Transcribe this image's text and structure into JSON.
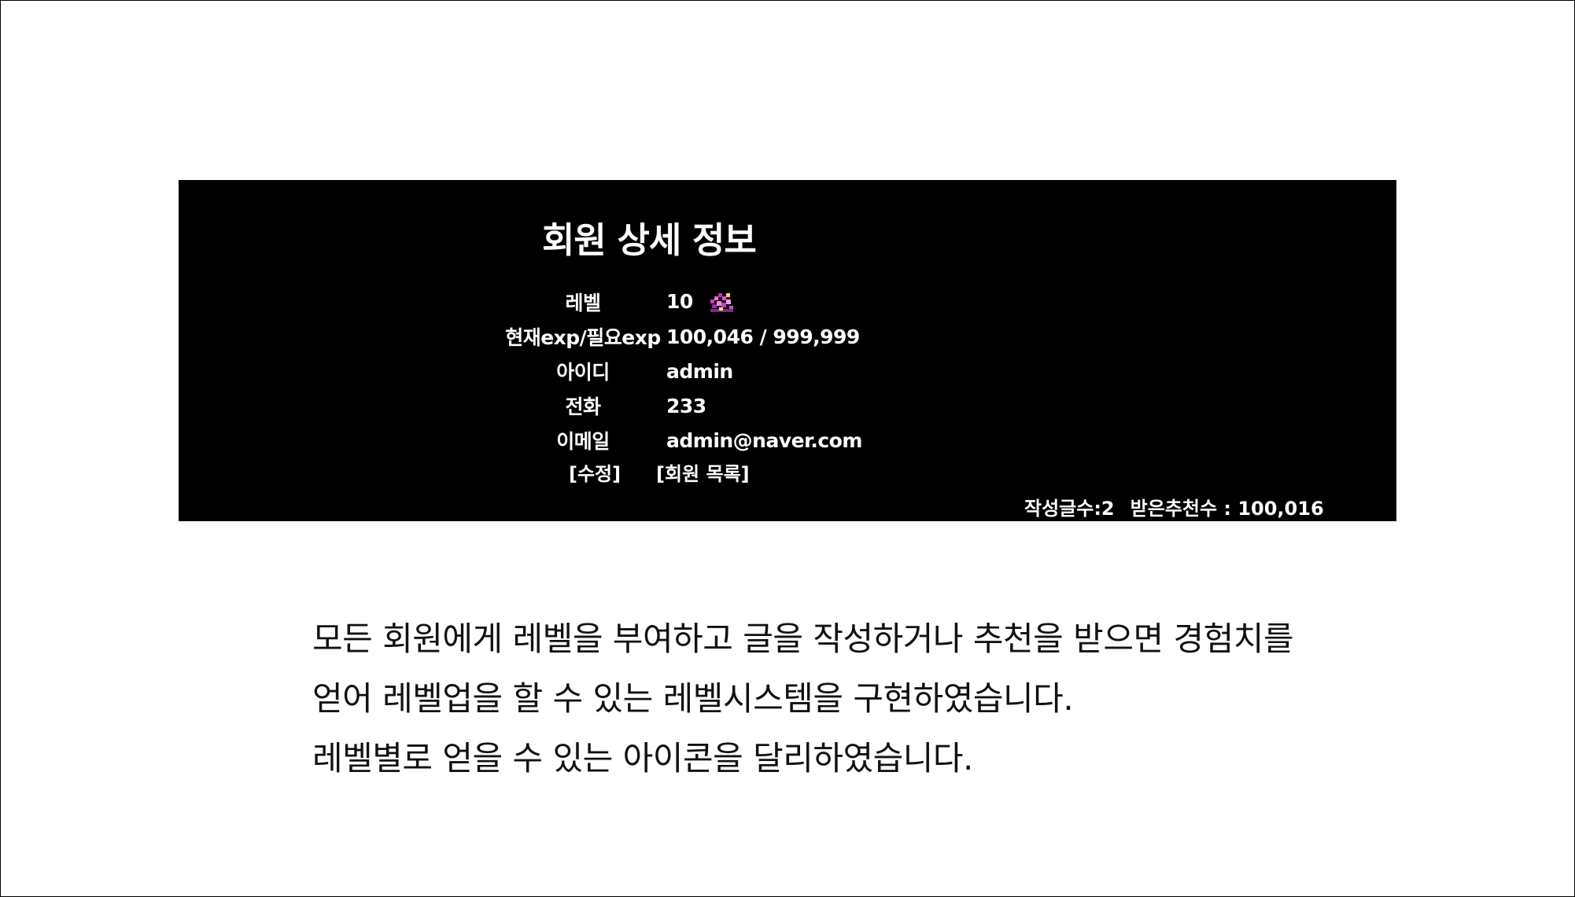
{
  "panel": {
    "title": "회원 상세 정보",
    "rows": [
      {
        "label": "레벨",
        "value": "10",
        "icon": "level-badge-icon"
      },
      {
        "label": "현재exp/필요exp",
        "value": "100,046 / 999,999"
      },
      {
        "label": "아이디",
        "value": "admin"
      },
      {
        "label": "전화",
        "value": "233"
      },
      {
        "label": "이메일",
        "value": "admin@naver.com"
      }
    ],
    "actions": {
      "edit": "[수정]",
      "member_list": "[회원 목록]"
    },
    "stats": {
      "posts": "작성글수:2",
      "recommendations": "받은추천수 : 100,016"
    }
  },
  "description": {
    "lines": [
      "모든 회원에게 레벨을 부여하고 글을 작성하거나 추천을 받으면 경험치를",
      "얻어 레벨업을 할 수 있는 레벨시스템을 구현하였습니다.",
      "레벨별로 얻을 수 있는 아이콘을 달리하였습니다."
    ]
  }
}
